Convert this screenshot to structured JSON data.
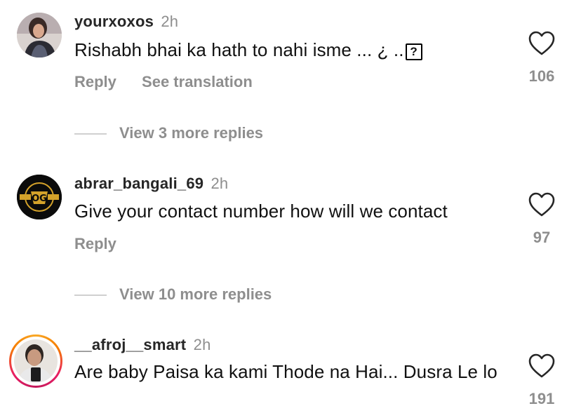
{
  "comments": [
    {
      "username": "yourxoxos",
      "time": "2h",
      "text": "Rishabh bhai ka hath to nahi isme ... ¿ ..",
      "text_suffix_glyph": "?",
      "actions": [
        "Reply",
        "See translation"
      ],
      "likes": "106",
      "view_more": "View 3 more replies"
    },
    {
      "username": "abrar_bangali_69",
      "time": "2h",
      "text": "Give your contact number how will we contact",
      "actions": [
        "Reply"
      ],
      "likes": "97",
      "view_more": "View 10 more replies",
      "avatar_text": "OG"
    },
    {
      "username": "__afroj__smart",
      "time": "2h",
      "text": "Are baby Paisa ka kami Thode na Hai... Dusra Le lo",
      "likes": "191"
    }
  ],
  "colors": {
    "secondary_text": "#8e8e8e",
    "primary_text": "#262626",
    "story_ring": "#e91e63"
  }
}
